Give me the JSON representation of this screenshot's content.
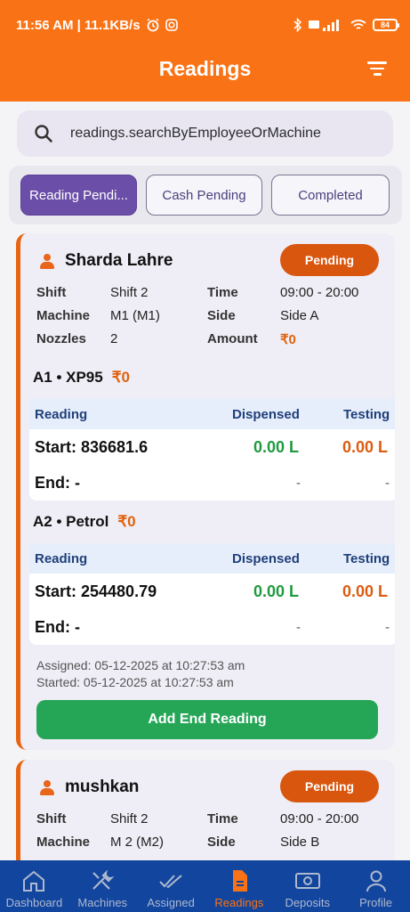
{
  "status_bar": {
    "time_speed": "11:56 AM | 11.1KB/s",
    "battery": "84"
  },
  "header": {
    "title": "Readings"
  },
  "search": {
    "placeholder": "readings.searchByEmployeeOrMachine"
  },
  "tabs": [
    {
      "label": "Reading Pendi...",
      "active": true
    },
    {
      "label": "Cash Pending",
      "active": false
    },
    {
      "label": "Completed",
      "active": false
    }
  ],
  "cards": [
    {
      "name": "Sharda Lahre",
      "badge": "Pending",
      "labels": {
        "shift": "Shift",
        "machine": "Machine",
        "nozzles": "Nozzles",
        "time": "Time",
        "side": "Side",
        "amount": "Amount"
      },
      "shift": "Shift 2",
      "machine": "M1 (M1)",
      "nozzles": "2",
      "time": "09:00 - 20:00",
      "side": "Side A",
      "amount": "₹0",
      "nozzle_list": [
        {
          "title": "A1 • XP95",
          "amount": "₹0",
          "headers": {
            "reading": "Reading",
            "dispensed": "Dispensed",
            "testing": "Testing"
          },
          "start": "Start: 836681.6",
          "dispensed": "0.00 L",
          "testing": "0.00 L",
          "end": "End: -",
          "end_dispensed": "-",
          "end_testing": "-"
        },
        {
          "title": "A2 • Petrol",
          "amount": "₹0",
          "headers": {
            "reading": "Reading",
            "dispensed": "Dispensed",
            "testing": "Testing"
          },
          "start": "Start: 254480.79",
          "dispensed": "0.00 L",
          "testing": "0.00 L",
          "end": "End: -",
          "end_dispensed": "-",
          "end_testing": "-"
        }
      ],
      "assigned": "Assigned: 05-12-2025 at 10:27:53 am",
      "started": "Started: 05-12-2025 at 10:27:53 am",
      "action": "Add End Reading"
    },
    {
      "name": "mushkan",
      "badge": "Pending",
      "labels": {
        "shift": "Shift",
        "machine": "Machine",
        "time": "Time",
        "side": "Side"
      },
      "shift": "Shift 2",
      "machine": "M 2 (M2)",
      "time": "09:00 - 20:00",
      "side": "Side B"
    }
  ],
  "bottom_nav": [
    {
      "label": "Dashboard",
      "icon": "home-icon",
      "active": false
    },
    {
      "label": "Machines",
      "icon": "tools-icon",
      "active": false
    },
    {
      "label": "Assigned",
      "icon": "double-check-icon",
      "active": false
    },
    {
      "label": "Readings",
      "icon": "document-icon",
      "active": true
    },
    {
      "label": "Deposits",
      "icon": "cash-icon",
      "active": false
    },
    {
      "label": "Profile",
      "icon": "person-icon",
      "active": false
    }
  ],
  "colors": {
    "primary": "#f97316",
    "accent_purple": "#6b4ea8",
    "pending_badge": "#d9560f",
    "success": "#25a657",
    "nav_bg": "#12459e"
  }
}
